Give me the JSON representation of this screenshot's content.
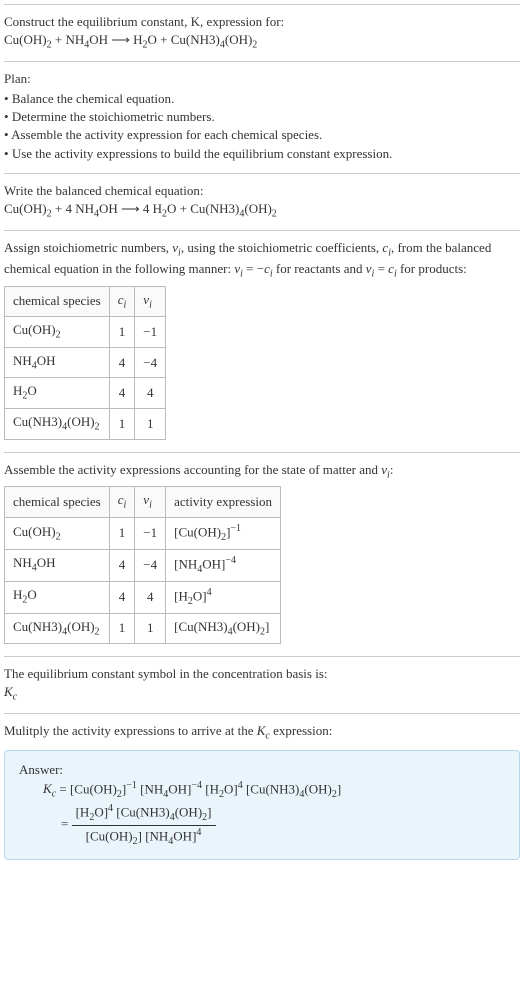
{
  "intro": {
    "line1": "Construct the equilibrium constant, K, expression for:",
    "eq_html": "Cu(OH)<sub>2</sub> + NH<sub>4</sub>OH  ⟶  H<sub>2</sub>O + Cu(NH3)<sub>4</sub>(OH)<sub>2</sub>"
  },
  "plan": {
    "title": "Plan:",
    "items": [
      "Balance the chemical equation.",
      "Determine the stoichiometric numbers.",
      "Assemble the activity expression for each chemical species.",
      "Use the activity expressions to build the equilibrium constant expression."
    ]
  },
  "balanced": {
    "title": "Write the balanced chemical equation:",
    "eq_html": "Cu(OH)<sub>2</sub> + 4 NH<sub>4</sub>OH  ⟶  4 H<sub>2</sub>O + Cu(NH3)<sub>4</sub>(OH)<sub>2</sub>"
  },
  "stoich": {
    "intro_html": "Assign stoichiometric numbers, <i>ν<sub>i</sub></i>, using the stoichiometric coefficients, <i>c<sub>i</sub></i>, from the balanced chemical equation in the following manner: <i>ν<sub>i</sub></i> = −<i>c<sub>i</sub></i> for reactants and <i>ν<sub>i</sub></i> = <i>c<sub>i</sub></i> for products:",
    "headers": [
      "chemical species",
      "cᵢ",
      "νᵢ"
    ],
    "rows": [
      {
        "sp": "Cu(OH)<sub>2</sub>",
        "c": "1",
        "v": "−1"
      },
      {
        "sp": "NH<sub>4</sub>OH",
        "c": "4",
        "v": "−4"
      },
      {
        "sp": "H<sub>2</sub>O",
        "c": "4",
        "v": "4"
      },
      {
        "sp": "Cu(NH3)<sub>4</sub>(OH)<sub>2</sub>",
        "c": "1",
        "v": "1"
      }
    ]
  },
  "activity": {
    "intro_html": "Assemble the activity expressions accounting for the state of matter and <i>ν<sub>i</sub></i>:",
    "headers": [
      "chemical species",
      "cᵢ",
      "νᵢ",
      "activity expression"
    ],
    "rows": [
      {
        "sp": "Cu(OH)<sub>2</sub>",
        "c": "1",
        "v": "−1",
        "a": "[Cu(OH)<sub>2</sub>]<sup>−1</sup>"
      },
      {
        "sp": "NH<sub>4</sub>OH",
        "c": "4",
        "v": "−4",
        "a": "[NH<sub>4</sub>OH]<sup>−4</sup>"
      },
      {
        "sp": "H<sub>2</sub>O",
        "c": "4",
        "v": "4",
        "a": "[H<sub>2</sub>O]<sup>4</sup>"
      },
      {
        "sp": "Cu(NH3)<sub>4</sub>(OH)<sub>2</sub>",
        "c": "1",
        "v": "1",
        "a": "[Cu(NH3)<sub>4</sub>(OH)<sub>2</sub>]"
      }
    ]
  },
  "kc_symbol": {
    "line1": "The equilibrium constant symbol in the concentration basis is:",
    "line2_html": "<i>K<sub>c</sub></i>"
  },
  "multiply": {
    "intro_html": "Mulitply the activity expressions to arrive at the <i>K<sub>c</sub></i> expression:"
  },
  "answer": {
    "label": "Answer:",
    "line1_html": "<i>K<sub>c</sub></i> = [Cu(OH)<sub>2</sub>]<sup>−1</sup> [NH<sub>4</sub>OH]<sup>−4</sup> [H<sub>2</sub>O]<sup>4</sup> [Cu(NH3)<sub>4</sub>(OH)<sub>2</sub>]",
    "frac_num_html": "[H<sub>2</sub>O]<sup>4</sup> [Cu(NH3)<sub>4</sub>(OH)<sub>2</sub>]",
    "frac_den_html": "[Cu(OH)<sub>2</sub>] [NH<sub>4</sub>OH]<sup>4</sup>"
  }
}
